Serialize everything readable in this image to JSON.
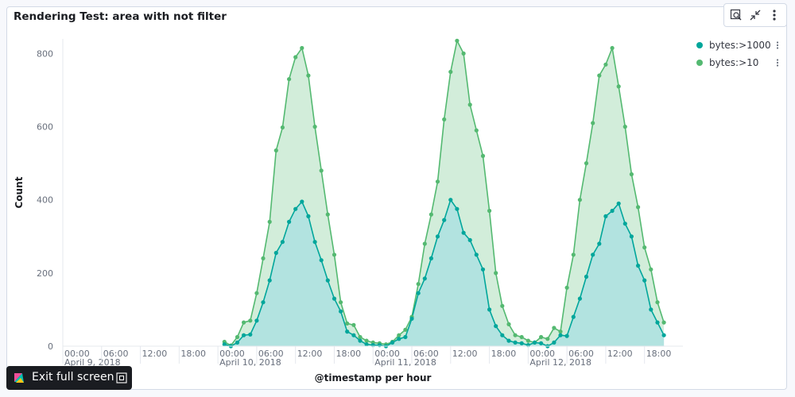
{
  "panel": {
    "title": "Rendering Test: area with not filter"
  },
  "toolbar": {
    "inspect_icon": "inspect-icon",
    "minimize_icon": "minimize-icon",
    "options_icon": "vertical-dots-icon"
  },
  "exit_fullscreen": {
    "label": "Exit full screen",
    "logo_icon": "kibana-logo-icon",
    "icon": "fullscreen-exit-icon"
  },
  "colors": {
    "series_1000": "#00a69b",
    "series_10": "#54b971",
    "area_1000": "#b0e3e0",
    "area_10": "#cdebd6",
    "axis": "#e5e8ee",
    "grid": "#eef1f5",
    "text": "#69707d"
  },
  "chart_data": {
    "type": "area",
    "title": "",
    "xlabel": "@timestamp per hour",
    "ylabel": "Count",
    "ylim": [
      0,
      840
    ],
    "y_ticks": [
      0,
      200,
      400,
      600,
      800
    ],
    "x_ticks": [
      {
        "label": "00:00",
        "sub": "April 9, 2018",
        "hour": 0
      },
      {
        "label": "06:00",
        "sub": "",
        "hour": 6
      },
      {
        "label": "12:00",
        "sub": "",
        "hour": 12
      },
      {
        "label": "18:00",
        "sub": "",
        "hour": 18
      },
      {
        "label": "00:00",
        "sub": "April 10, 2018",
        "hour": 24
      },
      {
        "label": "06:00",
        "sub": "",
        "hour": 30
      },
      {
        "label": "12:00",
        "sub": "",
        "hour": 36
      },
      {
        "label": "18:00",
        "sub": "",
        "hour": 42
      },
      {
        "label": "00:00",
        "sub": "April 11, 2018",
        "hour": 48
      },
      {
        "label": "06:00",
        "sub": "",
        "hour": 54
      },
      {
        "label": "12:00",
        "sub": "",
        "hour": 60
      },
      {
        "label": "18:00",
        "sub": "",
        "hour": 66
      },
      {
        "label": "00:00",
        "sub": "April 12, 2018",
        "hour": 72
      },
      {
        "label": "06:00",
        "sub": "",
        "hour": 78
      },
      {
        "label": "12:00",
        "sub": "",
        "hour": 84
      },
      {
        "label": "18:00",
        "sub": "",
        "hour": 90
      }
    ],
    "x_start_hour": 25,
    "legend_position": "top-right",
    "series": [
      {
        "name": "bytes:>10",
        "values": [
          12,
          2,
          25,
          65,
          70,
          145,
          240,
          340,
          535,
          598,
          730,
          790,
          815,
          740,
          600,
          480,
          360,
          250,
          120,
          62,
          58,
          25,
          15,
          10,
          8,
          5,
          12,
          30,
          45,
          80,
          170,
          280,
          360,
          450,
          620,
          750,
          835,
          800,
          660,
          590,
          520,
          370,
          200,
          110,
          60,
          30,
          25,
          15,
          10,
          25,
          20,
          50,
          40,
          160,
          250,
          400,
          500,
          610,
          740,
          770,
          815,
          710,
          600,
          470,
          380,
          270,
          210,
          120,
          65
        ]
      },
      {
        "name": "bytes:>1000",
        "values": [
          5,
          0,
          10,
          30,
          32,
          70,
          120,
          180,
          255,
          285,
          340,
          375,
          395,
          355,
          285,
          235,
          180,
          130,
          95,
          40,
          30,
          15,
          5,
          3,
          3,
          0,
          10,
          20,
          25,
          75,
          145,
          185,
          240,
          300,
          345,
          400,
          375,
          310,
          290,
          250,
          210,
          100,
          55,
          30,
          15,
          10,
          8,
          3,
          10,
          8,
          0,
          10,
          30,
          28,
          80,
          130,
          190,
          250,
          280,
          355,
          370,
          390,
          335,
          300,
          220,
          180,
          100,
          65,
          30
        ]
      }
    ]
  }
}
